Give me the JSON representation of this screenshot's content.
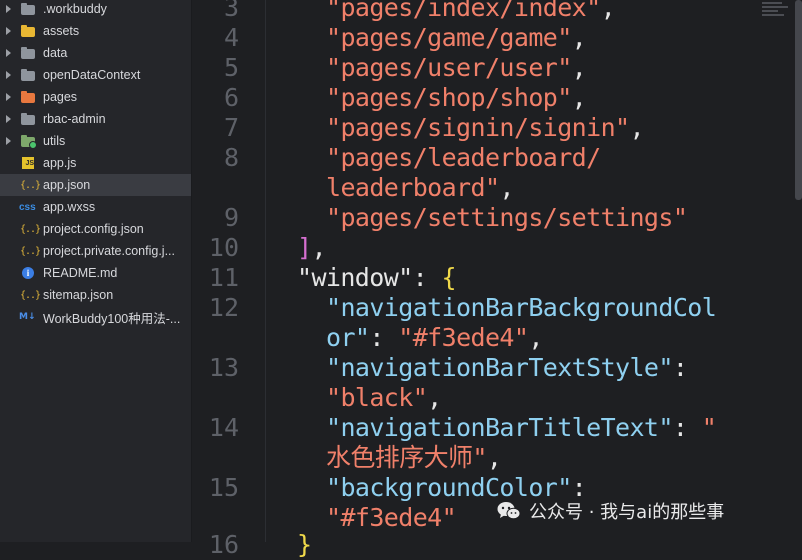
{
  "sidebar": {
    "items": [
      {
        "label": ".workbuddy",
        "icon": "folder-icon",
        "color": "#8f959d",
        "expandable": true
      },
      {
        "label": "assets",
        "icon": "folder-icon",
        "color": "#e9b733",
        "expandable": true
      },
      {
        "label": "data",
        "icon": "folder-icon",
        "color": "#8f959d",
        "expandable": true
      },
      {
        "label": "openDataContext",
        "icon": "folder-icon",
        "color": "#8f959d",
        "expandable": true
      },
      {
        "label": "pages",
        "icon": "folder-icon",
        "color": "#e8783f",
        "expandable": true
      },
      {
        "label": "rbac-admin",
        "icon": "folder-icon",
        "color": "#8f959d",
        "expandable": true
      },
      {
        "label": "utils",
        "icon": "folder-icon",
        "color": "#7ea86b",
        "expandable": true
      },
      {
        "label": "app.js",
        "icon": "js-file-icon"
      },
      {
        "label": "app.json",
        "icon": "json-file-icon",
        "selected": true
      },
      {
        "label": "app.wxss",
        "icon": "css-file-icon"
      },
      {
        "label": "project.config.json",
        "icon": "json-file-icon"
      },
      {
        "label": "project.private.config.j...",
        "icon": "json-file-icon"
      },
      {
        "label": "README.md",
        "icon": "info-file-icon"
      },
      {
        "label": "sitemap.json",
        "icon": "json-file-icon"
      },
      {
        "label": "WorkBuddy100种用法-...",
        "icon": "markdown-file-icon"
      }
    ],
    "js_icon_text": "JS",
    "json_icon_text": "{..}",
    "css_icon_text": "css",
    "info_icon_text": "i",
    "md_icon_text": "M↓"
  },
  "editor": {
    "line_numbers": [
      "3",
      "4",
      "5",
      "6",
      "7",
      "8",
      "9",
      "10",
      "11",
      "12",
      "13",
      "14",
      "15",
      "16"
    ],
    "lines": {
      "l3": "\"pages/index/index\"",
      "l4": "\"pages/game/game\"",
      "l5": "\"pages/user/user\"",
      "l6": "\"pages/shop/shop\"",
      "l7": "\"pages/signin/signin\"",
      "l8a": "\"pages/leaderboard/",
      "l8b": "leaderboard\"",
      "l9": "\"pages/settings/settings\"",
      "l10_bracket": "]",
      "l11_key": "\"window\"",
      "l11_brace": "{",
      "l12_key_a": "\"navigationBarBackgroundCol",
      "l12_key_b": "or\"",
      "l12_val": "\"#f3ede4\"",
      "l13_key": "\"navigationBarTextStyle\"",
      "l13_val": "\"black\"",
      "l14_key": "\"navigationBarTitleText\"",
      "l14_val_a": "\"",
      "l14_val_b": "水色排序大师\"",
      "l15_key": "\"backgroundColor\"",
      "l15_val": "\"#f3ede4\"",
      "l16": "}"
    },
    "comma": ",",
    "colon": ":"
  },
  "watermark": {
    "text": "公众号 · 我与ai的那些事"
  },
  "colors": {
    "string": "#f0806a",
    "key": "#8fd0f0",
    "bracket": "#d66fd1",
    "brace": "#f0d94a",
    "selected_row": "#3a3c42"
  }
}
